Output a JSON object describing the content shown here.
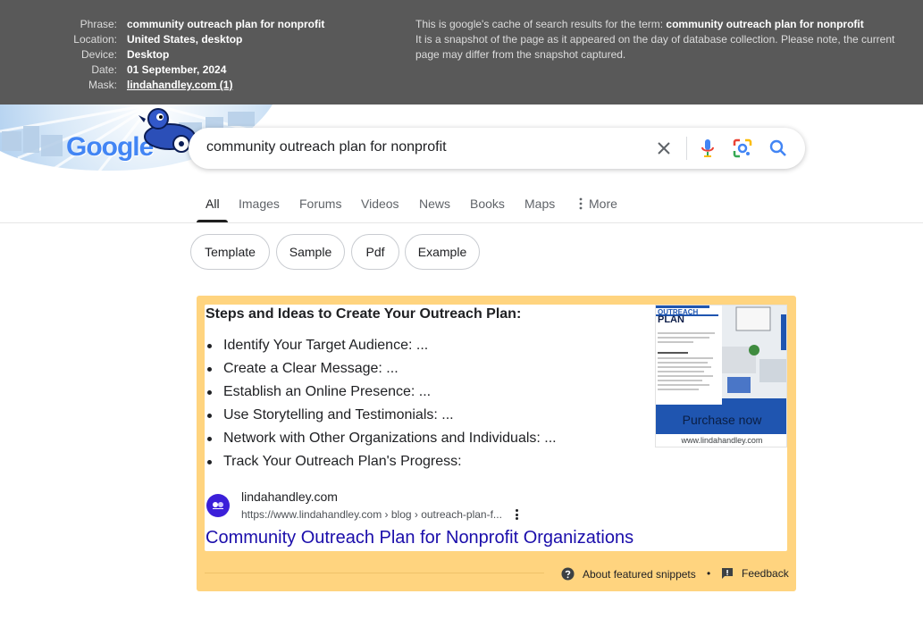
{
  "cache_header": {
    "meta": [
      {
        "key": "Phrase:",
        "value": "community outreach plan for nonprofit"
      },
      {
        "key": "Location:",
        "value": "United States, desktop"
      },
      {
        "key": "Device:",
        "value": "Desktop"
      },
      {
        "key": "Date:",
        "value": "01 September, 2024"
      },
      {
        "key": "Mask:",
        "value": "lindahandley.com (1)"
      }
    ],
    "note_prefix": "This is google's cache of search results for the term: ",
    "note_term": "community outreach plan for nonprofit",
    "note_rest": "It is a snapshot of the page as it appeared on the day of database collection. Please note, the current page may differ from the snapshot captured."
  },
  "logo": {
    "text": "Google"
  },
  "search": {
    "query": "community outreach plan for nonprofit",
    "icons": [
      "close-icon",
      "microphone-icon",
      "lens-icon",
      "search-icon"
    ]
  },
  "tabs": [
    "All",
    "Images",
    "Forums",
    "Videos",
    "News",
    "Books",
    "Maps",
    "More"
  ],
  "active_tab": "All",
  "chips": [
    "Template",
    "Sample",
    "Pdf",
    "Example"
  ],
  "snippet": {
    "title": "Steps and Ideas to Create Your Outreach Plan:",
    "items": [
      "Identify Your Target Audience: ...",
      "Create a Clear Message: ...",
      "Establish an Online Presence: ...",
      "Use Storytelling and Testimonials: ...",
      "Network with Other Organizations and Individuals: ...",
      "Track Your Outreach Plan's Progress:"
    ],
    "thumbnail": {
      "heading_line1": "OUTREACH",
      "heading_line2": "PLAN",
      "button": "Purchase now",
      "caption": "www.lindahandley.com"
    },
    "site_name": "lindahandley.com",
    "site_url": "https://www.lindahandley.com › blog › outreach-plan-f...",
    "link": "Community Outreach Plan for Nonprofit Organizations",
    "about_label": "About featured snippets",
    "separator": "•",
    "feedback_label": "Feedback"
  },
  "colors": {
    "cache_bg": "#595959",
    "snippet_frame": "#ffd47f",
    "link": "#1a0dab",
    "thumb_button": "#1f55b0"
  }
}
